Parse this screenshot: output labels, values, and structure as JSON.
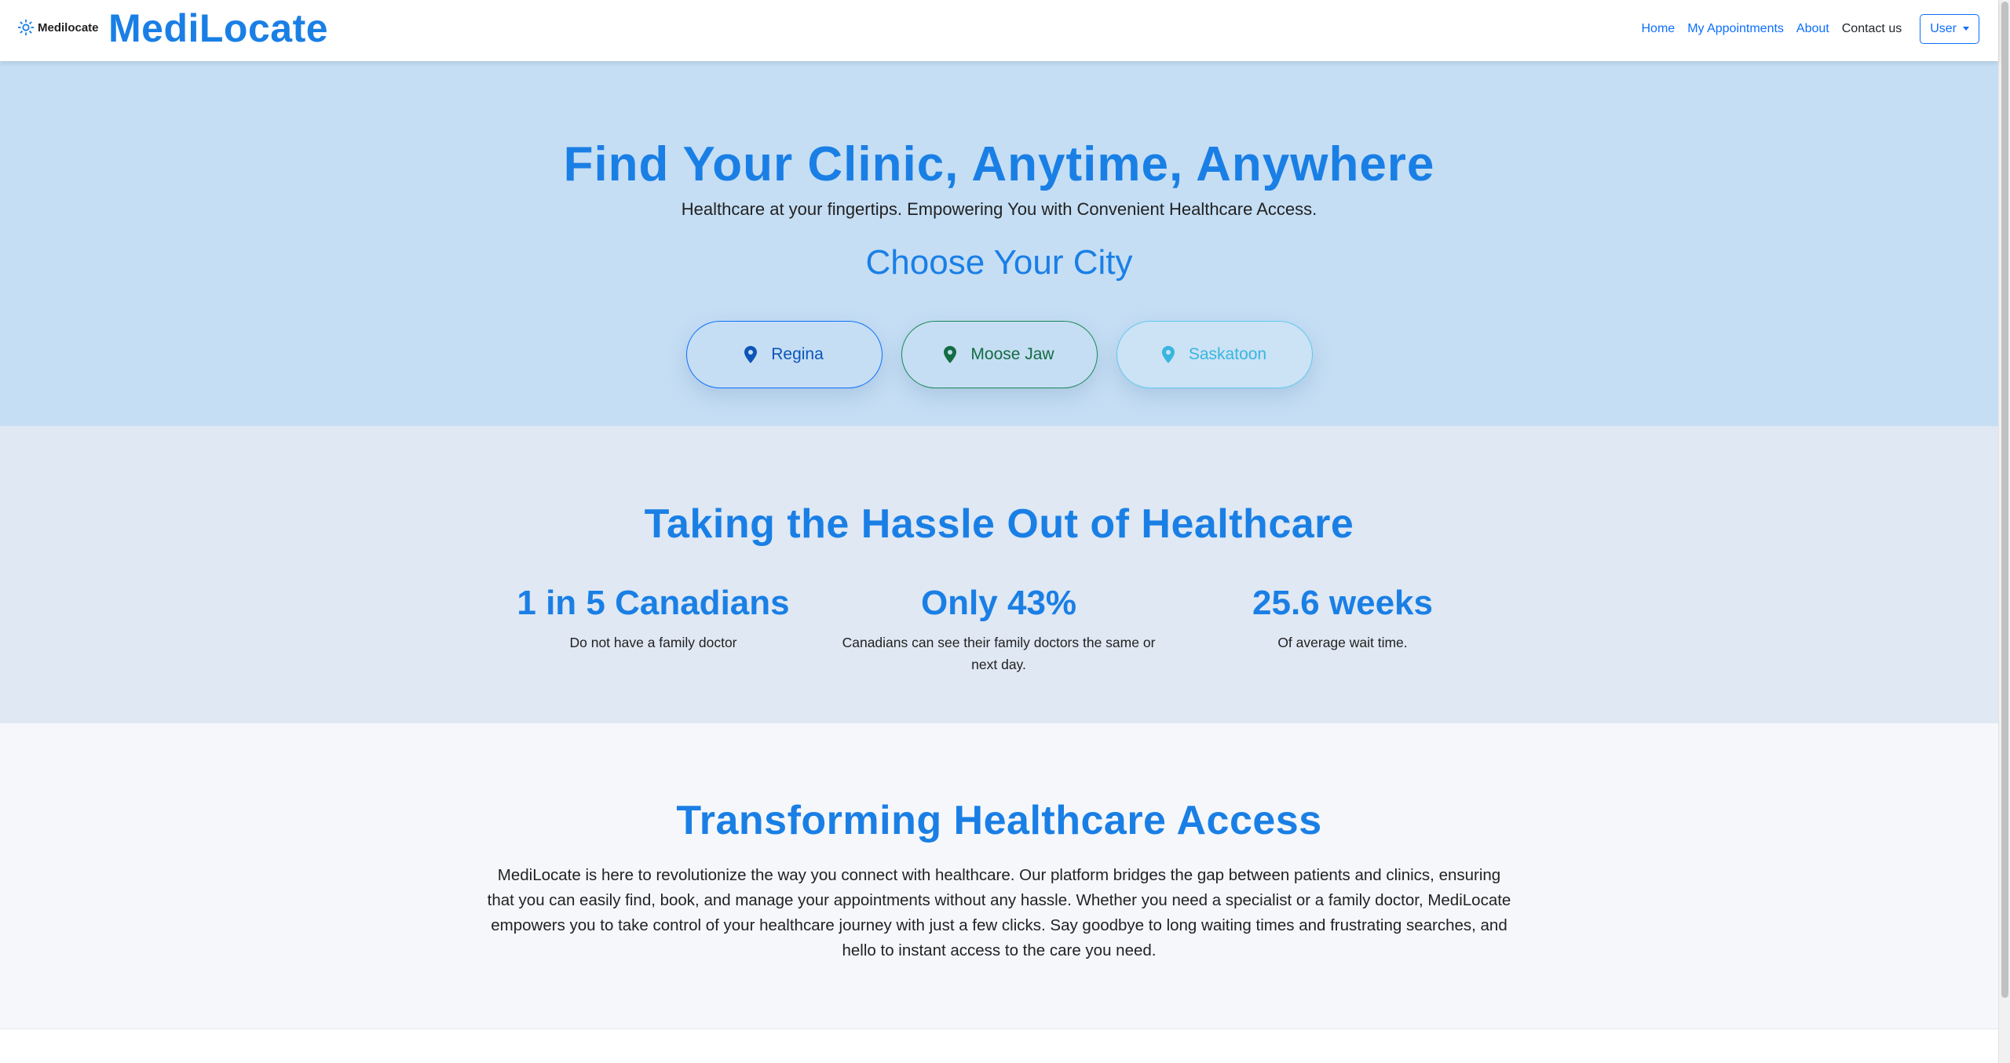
{
  "navbar": {
    "logo_text": "Medilocate",
    "brand_name": "MediLocate",
    "links": {
      "home": "Home",
      "appointments": "My Appointments",
      "about": "About",
      "contact": "Contact us"
    },
    "user_button": "User"
  },
  "hero": {
    "title": "Find Your Clinic, Anytime, Anywhere",
    "subtitle": "Healthcare at your fingertips. Empowering You with Convenient Healthcare Access.",
    "choose_city": "Choose Your City",
    "cities": {
      "regina": "Regina",
      "moose_jaw": "Moose Jaw",
      "saskatoon": "Saskatoon"
    }
  },
  "stats": {
    "title": "Taking the Hassle Out of Healthcare",
    "items": [
      {
        "value": "1 in 5 Canadians",
        "desc": "Do not have a family doctor"
      },
      {
        "value": "Only 43%",
        "desc": "Canadians can see their family doctors the same or next day."
      },
      {
        "value": "25.6 weeks",
        "desc": "Of average wait time."
      }
    ]
  },
  "transform": {
    "title": "Transforming Healthcare Access",
    "body": "MediLocate is here to revolutionize the way you connect with healthcare. Our platform bridges the gap between patients and clinics, ensuring that you can easily find, book, and manage your appointments without any hassle. Whether you need a specialist or a family doctor, MediLocate empowers you to take control of your healthcare journey with just a few clicks. Say goodbye to long waiting times and frustrating searches, and hello to instant access to the care you need."
  },
  "colors": {
    "brand_blue": "#1a7fe5",
    "hero_bg": "#c5def4",
    "stats_bg": "#dfe8f3",
    "transform_bg": "#f5f7fb"
  },
  "icons": {
    "logo": "gear-icon",
    "city_pin": "map-pin-icon",
    "dropdown": "caret-down-icon"
  }
}
